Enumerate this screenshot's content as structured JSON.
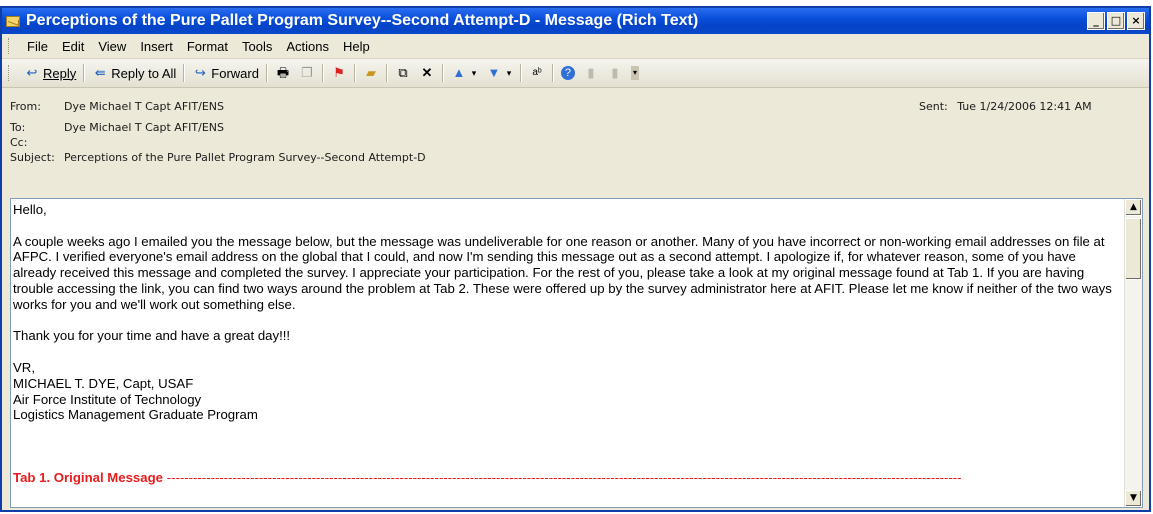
{
  "window": {
    "title": "Perceptions of the Pure Pallet Program Survey--Second Attempt-D - Message (Rich Text)",
    "controls": {
      "minimize": "_",
      "maximize": "□",
      "close": "×"
    }
  },
  "menu": [
    "File",
    "Edit",
    "View",
    "Insert",
    "Format",
    "Tools",
    "Actions",
    "Help"
  ],
  "toolbar": {
    "reply": "Reply",
    "reply_all": "Reply to All",
    "forward": "Forward",
    "icons": [
      "print-icon",
      "copy-icon",
      "flag-icon",
      "folder-icon",
      "move-icon",
      "delete-icon",
      "previous-icon",
      "next-icon",
      "address-book-icon",
      "help-icon"
    ]
  },
  "header": {
    "from_label": "From:",
    "from": "Dye Michael T Capt AFIT/ENS",
    "to_label": "To:",
    "to": "Dye Michael T Capt AFIT/ENS",
    "cc_label": "Cc:",
    "cc": "",
    "subject_label": "Subject:",
    "subject": "Perceptions of the Pure Pallet Program Survey--Second Attempt-D",
    "sent_label": "Sent:",
    "sent": "Tue 1/24/2006 12:41 AM"
  },
  "body": {
    "greeting": "Hello,",
    "paragraph": "A couple weeks ago I emailed you the message below, but the message was undeliverable for one reason or another.  Many of you have incorrect or non-working email addresses on file at AFPC.  I verified everyone's email address on the global that I could, and now I'm sending this message out as a second attempt.  I apologize if, for whatever reason, some of you have already received this message and completed the survey.  I appreciate your participation.  For the rest of you, please take a look at my original message found at Tab 1.  If you are having trouble accessing the link, you can find two ways around the problem at Tab 2.  These were offered up by the survey administrator here at AFIT.  Please let me know if neither of the two ways works for you and we'll work out something else.",
    "thanks": "Thank you for your time and have a great day!!!",
    "sig_vr": "VR,",
    "sig_name": "MICHAEL T. DYE, Capt, USAF",
    "sig_org": "Air Force Institute of Technology",
    "sig_program": "Logistics Management Graduate Program",
    "tab_heading": "Tab 1.  Original Message",
    "tab_rule": "-------------------------------------------------------------------------------------------------------------------------------------------------------------------------------------"
  },
  "colors": {
    "titlebar": "#0a4fd8",
    "tab_heading": "#e81c1c"
  }
}
